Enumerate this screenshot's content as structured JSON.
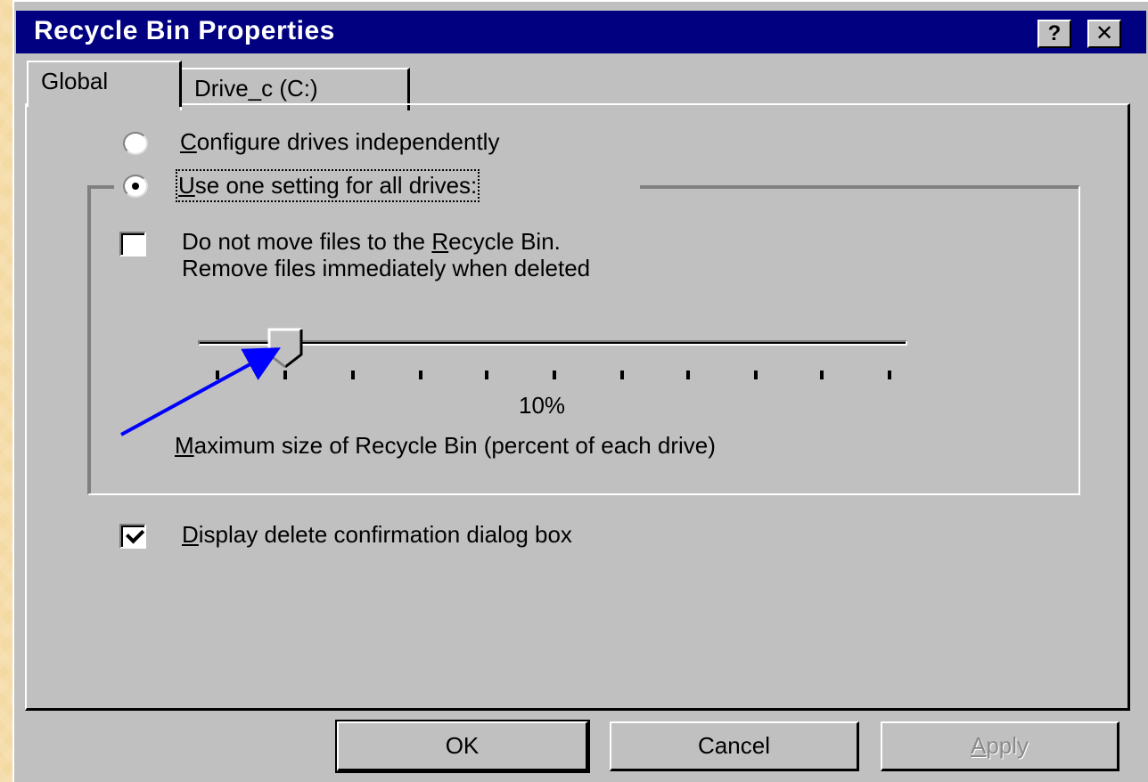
{
  "window": {
    "title": "Recycle Bin Properties",
    "help_label": "?",
    "close_label": "✕"
  },
  "tabs": [
    {
      "label": "Global",
      "active": true
    },
    {
      "label": "Drive_c (C:)",
      "active": false
    }
  ],
  "options": {
    "configure_independently": {
      "mnemonic": "C",
      "rest": "onfigure drives independently",
      "selected": false
    },
    "use_one_setting": {
      "mnemonic": "U",
      "rest": "se one setting for all drives:",
      "selected": true
    }
  },
  "no_recycle": {
    "line1_pre": "Do not move files to the ",
    "line1_mnemonic": "R",
    "line1_post": "ecycle Bin.",
    "line2": "Remove files immediately when deleted",
    "checked": false
  },
  "slider": {
    "value_label": "10%",
    "value_percent": 10,
    "caption_mnemonic": "M",
    "caption_rest": "aximum size of Recycle Bin (percent of each drive)"
  },
  "confirm_dialog": {
    "mnemonic": "D",
    "rest": "isplay delete confirmation dialog box",
    "checked": true
  },
  "buttons": {
    "ok": "OK",
    "cancel": "Cancel",
    "apply_mnemonic": "A",
    "apply_rest": "pply"
  },
  "colors": {
    "titlebar": "#000080",
    "face": "#c0c0c0",
    "arrow": "#0000ff",
    "background": "#f3d9a2"
  }
}
